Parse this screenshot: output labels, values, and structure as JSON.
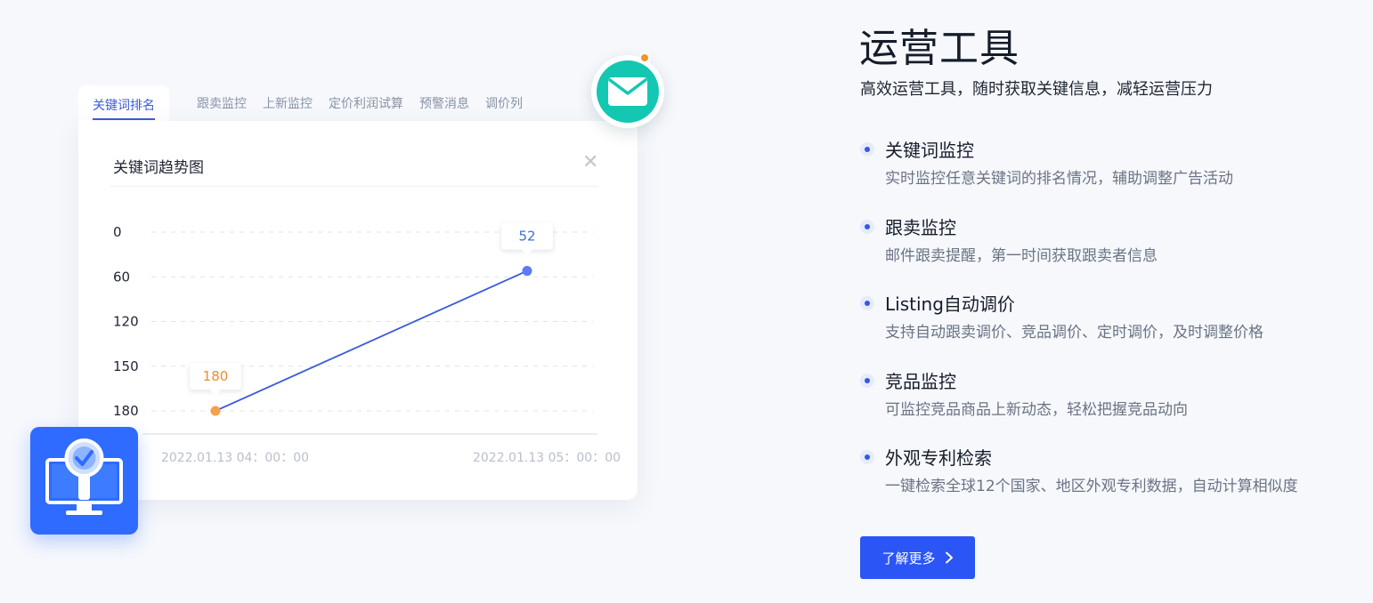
{
  "tabs": [
    {
      "label": "关键词排名",
      "active": true
    },
    {
      "label": "跟卖监控",
      "active": false
    },
    {
      "label": "上新监控",
      "active": false
    },
    {
      "label": "定价利润试算",
      "active": false
    },
    {
      "label": "预警消息",
      "active": false
    },
    {
      "label": "调价列",
      "active": false
    }
  ],
  "card": {
    "title": "关键词趋势图",
    "close_icon": "close-icon"
  },
  "chart_data": {
    "type": "line",
    "x": [
      "2022.01.13 04：00：00",
      "2022.01.13 05：00：00"
    ],
    "y_ticks": [
      0,
      60,
      120,
      150,
      180
    ],
    "y_inverted": true,
    "grid": true,
    "series": [
      {
        "values": [
          180,
          52
        ],
        "point_colors": [
          "#f5a04a",
          "#5b7cf5"
        ],
        "label_colors": [
          "#f08c2e",
          "#3b6fd8"
        ],
        "line_color": "#3b5bdb"
      }
    ],
    "data_labels": [
      "180",
      "52"
    ]
  },
  "decorations": {
    "mail_icon": "mail-icon",
    "mail_color": "#14c7b3",
    "notification_dot_color": "#f5922b",
    "monitor_icon": "monitor-search-icon",
    "monitor_color": "#2f6bff"
  },
  "hero": {
    "title": "运营工具",
    "subtitle": "高效运营工具，随时获取关键信息，减轻运营压力"
  },
  "features": [
    {
      "title": "关键词监控",
      "desc": "实时监控任意关键词的排名情况，辅助调整广告活动"
    },
    {
      "title": "跟卖监控",
      "desc": "邮件跟卖提醒，第一时间获取跟卖者信息"
    },
    {
      "title": "Listing自动调价",
      "desc": "支持自动跟卖调价、竞品调价、定时调价，及时调整价格"
    },
    {
      "title": "竞品监控",
      "desc": "可监控竞品商品上新动态，轻松把握竞品动向"
    },
    {
      "title": "外观专利检索",
      "desc": "一键检索全球12个国家、地区外观专利数据，自动计算相似度"
    }
  ],
  "cta": {
    "label": "了解更多",
    "icon": "chevron-right-icon",
    "color": "#2b55f5"
  }
}
